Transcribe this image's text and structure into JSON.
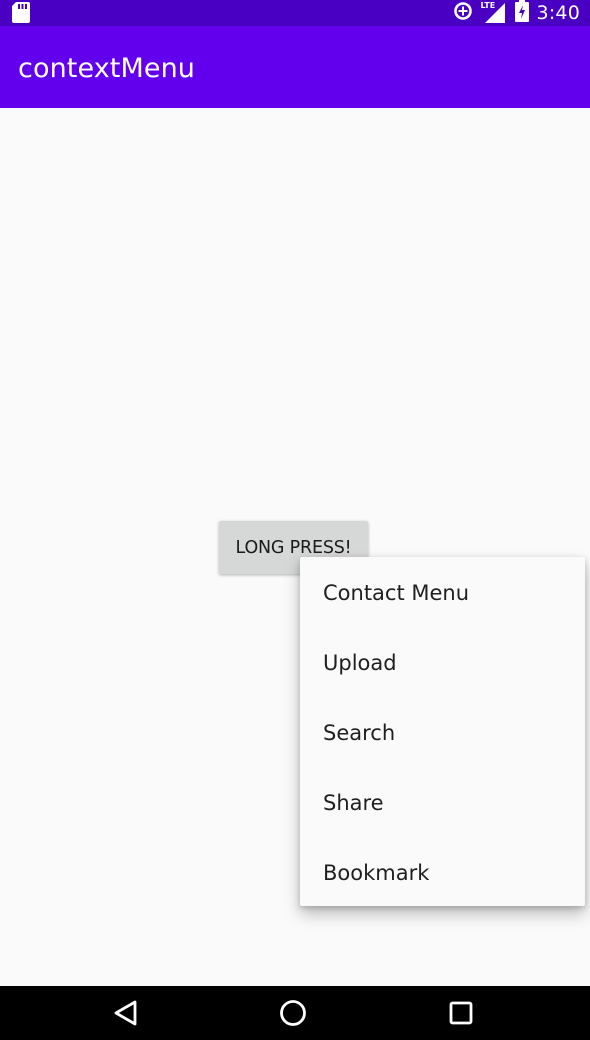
{
  "status_bar": {
    "time": "3:40",
    "network_label": "LTE",
    "icons": [
      "sd-card-icon",
      "data-saver-icon",
      "signal-icon",
      "battery-charging-icon"
    ],
    "background_color": "#4a00c2"
  },
  "app_bar": {
    "title": "contextMenu",
    "background_color": "#6200ee"
  },
  "main": {
    "button_label": "LONG PRESS!"
  },
  "context_menu": {
    "items": [
      {
        "label": "Contact Menu"
      },
      {
        "label": "Upload"
      },
      {
        "label": "Search"
      },
      {
        "label": "Share"
      },
      {
        "label": "Bookmark"
      }
    ]
  },
  "nav_bar": {
    "buttons": [
      "back-icon",
      "home-icon",
      "recents-icon"
    ]
  }
}
